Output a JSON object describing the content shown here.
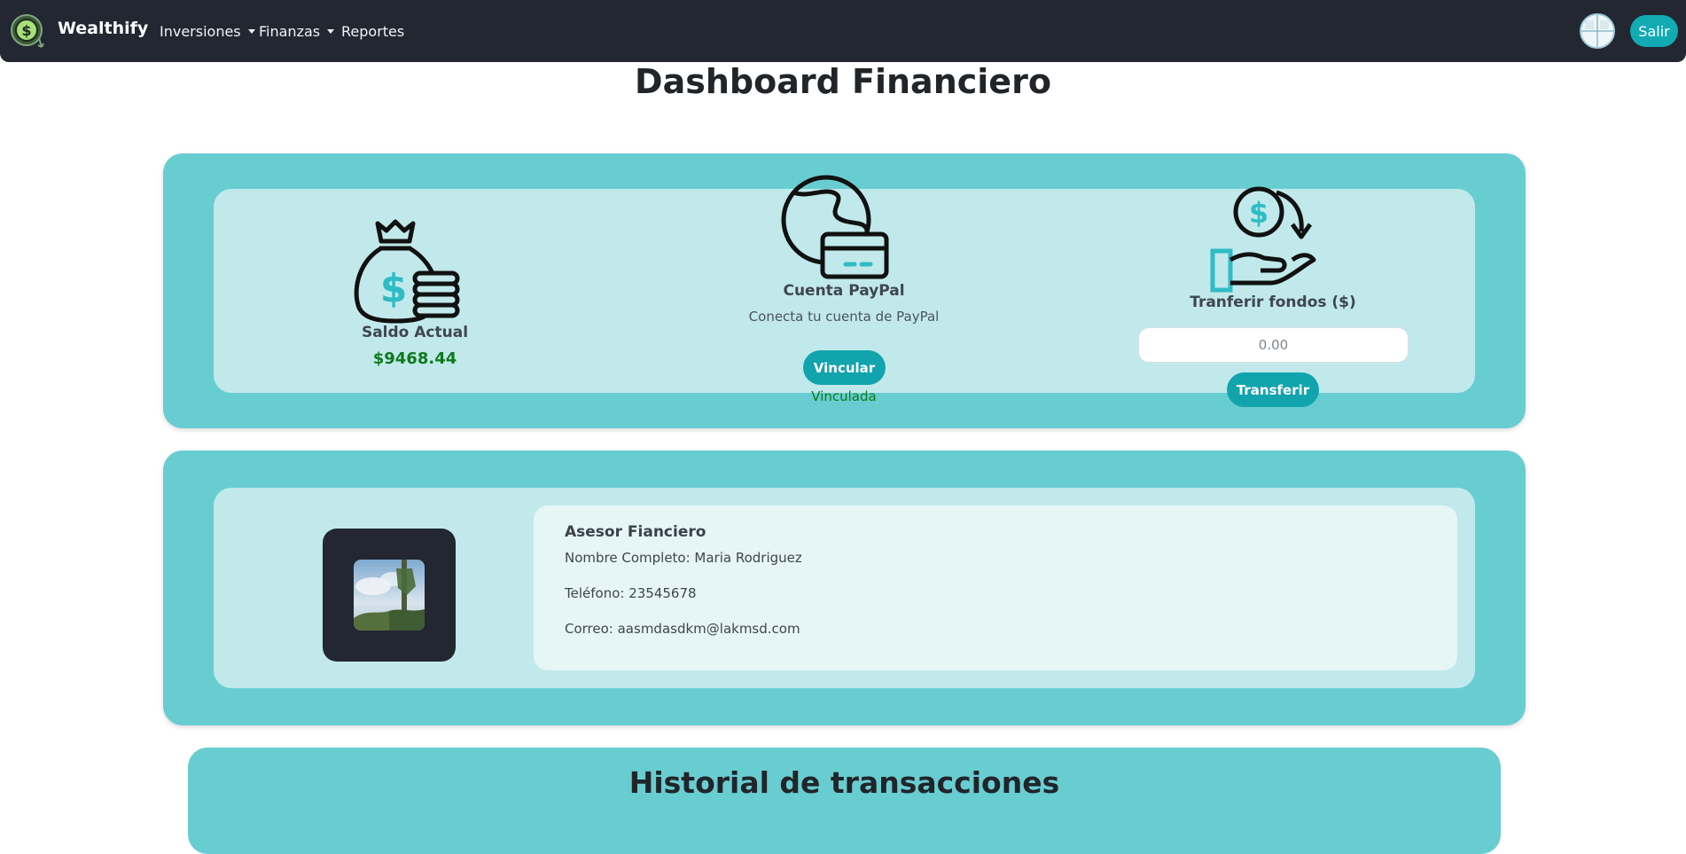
{
  "navbar": {
    "brand": "Wealthify",
    "menu": [
      {
        "label": "Inversiones",
        "dropdown": true
      },
      {
        "label": "Finanzas",
        "dropdown": true
      },
      {
        "label": "Reportes",
        "dropdown": false
      }
    ],
    "logout_label": "Salir"
  },
  "page": {
    "title": "Dashboard Financiero"
  },
  "balance": {
    "label": "Saldo Actual",
    "value": "$9468.44"
  },
  "paypal": {
    "title": "Cuenta PayPal",
    "subtitle": "Conecta tu cuenta de PayPal",
    "button_label": "Vincular",
    "status": "Vinculada"
  },
  "transfer": {
    "title": "Tranferir fondos ($)",
    "placeholder": "0.00",
    "button_label": "Transferir"
  },
  "advisor": {
    "heading": "Asesor Fianciero",
    "name_line": "Nombre Completo: Maria Rodriguez",
    "phone_line": "Teléfono: 23545678",
    "email_line": "Correo: aasmdasdkm@lakmsd.com"
  },
  "history": {
    "title": "Historial de transacciones"
  },
  "colors": {
    "navbar": "#222732",
    "accent": "#12aab3",
    "outer_card": "#68cdd1",
    "inner_card": "#c1e9eb",
    "balance_green": "#0d7a1c"
  },
  "icons": [
    "wealthify-logo-icon",
    "money-bag-icon",
    "globe-card-icon",
    "hand-coin-icon",
    "user-avatar-icon"
  ]
}
